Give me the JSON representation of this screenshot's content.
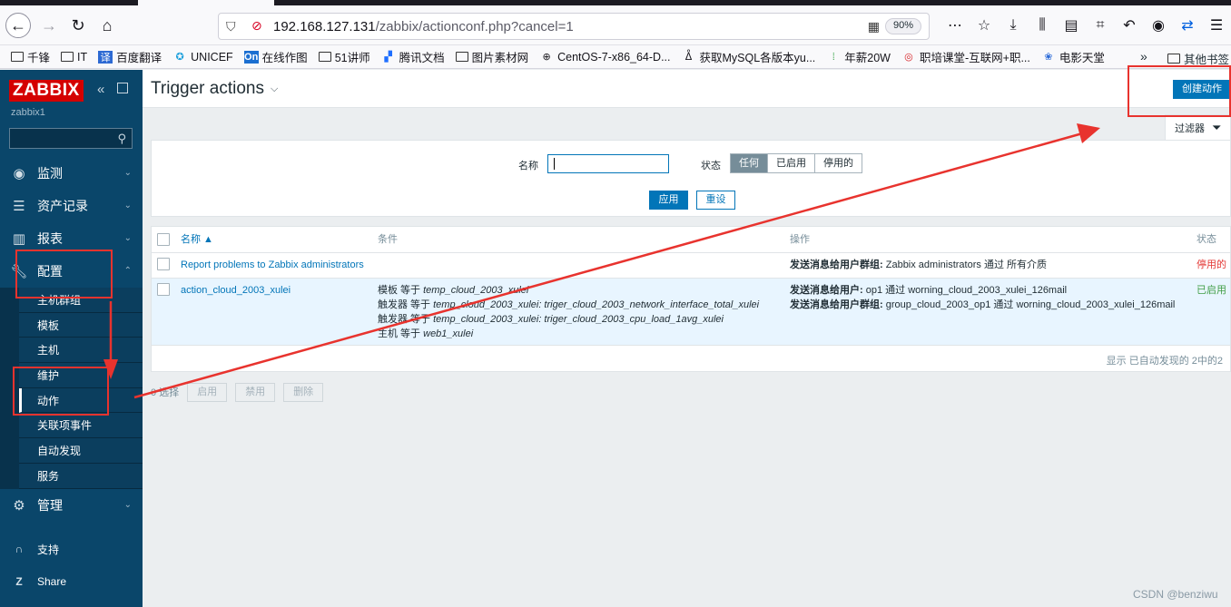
{
  "browser": {
    "url_host": "192.168.127.131",
    "url_path": "/zabbix/actionconf.php?cancel=1",
    "zoom": "90%",
    "bookmarks": [
      {
        "label": "千锋",
        "icon": "folder-icon"
      },
      {
        "label": "IT",
        "icon": "folder-icon"
      },
      {
        "label": "百度翻译",
        "icon": "translate-icon"
      },
      {
        "label": "UNICEF",
        "icon": "unicef-icon"
      },
      {
        "label": "在线作图",
        "icon": "on-icon"
      },
      {
        "label": "51讲师",
        "icon": "folder-icon"
      },
      {
        "label": "腾讯文档",
        "icon": "tencent-docs-icon"
      },
      {
        "label": "图片素材网",
        "icon": "folder-icon"
      },
      {
        "label": "CentOS-7-x86_64-D...",
        "icon": "globe-icon"
      },
      {
        "label": "获取MySQL各版本yu...",
        "icon": "user-icon"
      },
      {
        "label": "年薪20W",
        "icon": "leaf-icon"
      },
      {
        "label": "职培课堂-互联网+职...",
        "icon": "red-logo-icon"
      },
      {
        "label": "电影天堂",
        "icon": "paw-icon"
      }
    ],
    "other_bookmarks": "其他书签"
  },
  "sidebar": {
    "logo": "ZABBIX",
    "hostname": "zabbix1",
    "menu": [
      {
        "label": "监测",
        "icon": "eye-icon"
      },
      {
        "label": "资产记录",
        "icon": "list-icon"
      },
      {
        "label": "报表",
        "icon": "bar-chart-icon"
      },
      {
        "label": "配置",
        "icon": "wrench-icon"
      }
    ],
    "submenu": [
      "主机群组",
      "模板",
      "主机",
      "维护",
      "动作",
      "关联项事件",
      "自动发现",
      "服务"
    ],
    "admin": {
      "label": "管理",
      "icon": "gear-icon"
    },
    "bottom": [
      {
        "label": "支持",
        "icon": "headset-icon"
      },
      {
        "label": "Share",
        "icon": "share-icon"
      }
    ]
  },
  "header": {
    "title": "Trigger actions",
    "create_button": "创建动作",
    "filter_tab": "过滤器"
  },
  "filter": {
    "name_label": "名称",
    "name_value": "",
    "status_label": "状态",
    "status_options": [
      "任何",
      "已启用",
      "停用的"
    ],
    "status_selected": "任何",
    "apply": "应用",
    "reset": "重设"
  },
  "table": {
    "columns": {
      "name": "名称 ▲",
      "conditions": "条件",
      "operations": "操作",
      "status": "状态"
    },
    "rows": [
      {
        "name": "Report problems to Zabbix administrators",
        "conditions": [],
        "operations": [
          {
            "label": "发送消息给用户群组:",
            "text": "Zabbix administrators 通过 所有介质"
          }
        ],
        "status": "停用的"
      },
      {
        "name": "action_cloud_2003_xulei",
        "conditions": [
          {
            "label": "模板 等于 ",
            "value": "temp_cloud_2003_xulei"
          },
          {
            "label": "触发器 等于 ",
            "value": "temp_cloud_2003_xulei: triger_cloud_2003_network_interface_total_xulei"
          },
          {
            "label": "触发器 等于 ",
            "value": "temp_cloud_2003_xulei: triger_cloud_2003_cpu_load_1avg_xulei"
          },
          {
            "label": "主机 等于 ",
            "value": "web1_xulei"
          }
        ],
        "operations": [
          {
            "label": "发送消息给用户:",
            "text": "op1 通过 worning_cloud_2003_xulei_126mail"
          },
          {
            "label": "发送消息给用户群组:",
            "text": "group_cloud_2003_op1 通过 worning_cloud_2003_xulei_126mail"
          }
        ],
        "status": "已启用"
      }
    ],
    "footer": "显示 已自动发现的 2中的2"
  },
  "mass_actions": {
    "selected": "0 选择",
    "enable": "启用",
    "disable": "禁用",
    "delete": "删除"
  },
  "watermark": "CSDN @benziwu",
  "colors": {
    "accent": "#0275b8",
    "sidebar": "#0a466a",
    "annotation": "#e8332e",
    "disabled": "#e33734",
    "enabled": "#429e47"
  }
}
